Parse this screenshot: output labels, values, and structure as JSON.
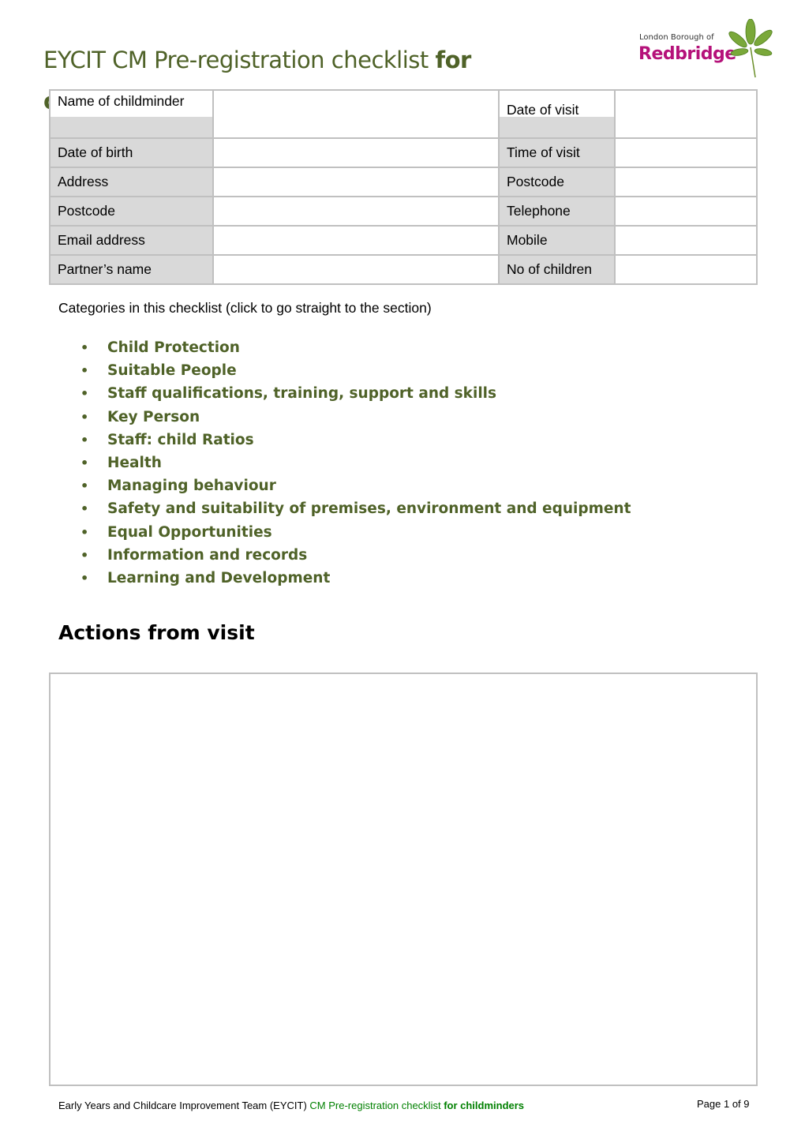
{
  "header": {
    "title_regular": "EYCIT CM Pre-registration checklist ",
    "title_bold": "for childminders",
    "logo_line1": "London Borough of",
    "logo_line2": "Redbridge"
  },
  "info_table": {
    "rows": [
      {
        "left_label": "Name of childminder",
        "left_value": "",
        "right_label": "Date of visit",
        "right_value": ""
      },
      {
        "left_label": "Date of birth",
        "left_value": "",
        "right_label": "Time of visit",
        "right_value": ""
      },
      {
        "left_label": "Address",
        "left_value": "",
        "right_label": "Postcode",
        "right_value": ""
      },
      {
        "left_label": "Postcode",
        "left_value": "",
        "right_label": "Telephone",
        "right_value": ""
      },
      {
        "left_label": "Email address",
        "left_value": "",
        "right_label": "Mobile",
        "right_value": ""
      },
      {
        "left_label": "Partner’s name",
        "left_value": "",
        "right_label": "No of children",
        "right_value": ""
      }
    ]
  },
  "categories": {
    "intro": "Categories in this checklist (click to go straight to the section)",
    "items": [
      "Child Protection",
      "Suitable People",
      "Staff qualifications, training, support and skills",
      "Key Person",
      "Staff: child Ratios",
      "Health",
      "Managing behaviour",
      "Safety and suitability of premises, environment and equipment",
      "Equal Opportunities",
      "Information and records",
      "Learning and Development"
    ]
  },
  "actions": {
    "heading": "Actions from visit",
    "content": ""
  },
  "footer": {
    "text_black": "Early Years and Childcare Improvement Team (EYCIT) ",
    "text_green": "CM Pre-registration checklist ",
    "text_green_bold": "for childminders",
    "page_label": "Page 1 of 9"
  },
  "colors": {
    "accent_green": "#4f6228",
    "brand_magenta": "#b5127a",
    "label_grey": "#d9d9d9"
  }
}
